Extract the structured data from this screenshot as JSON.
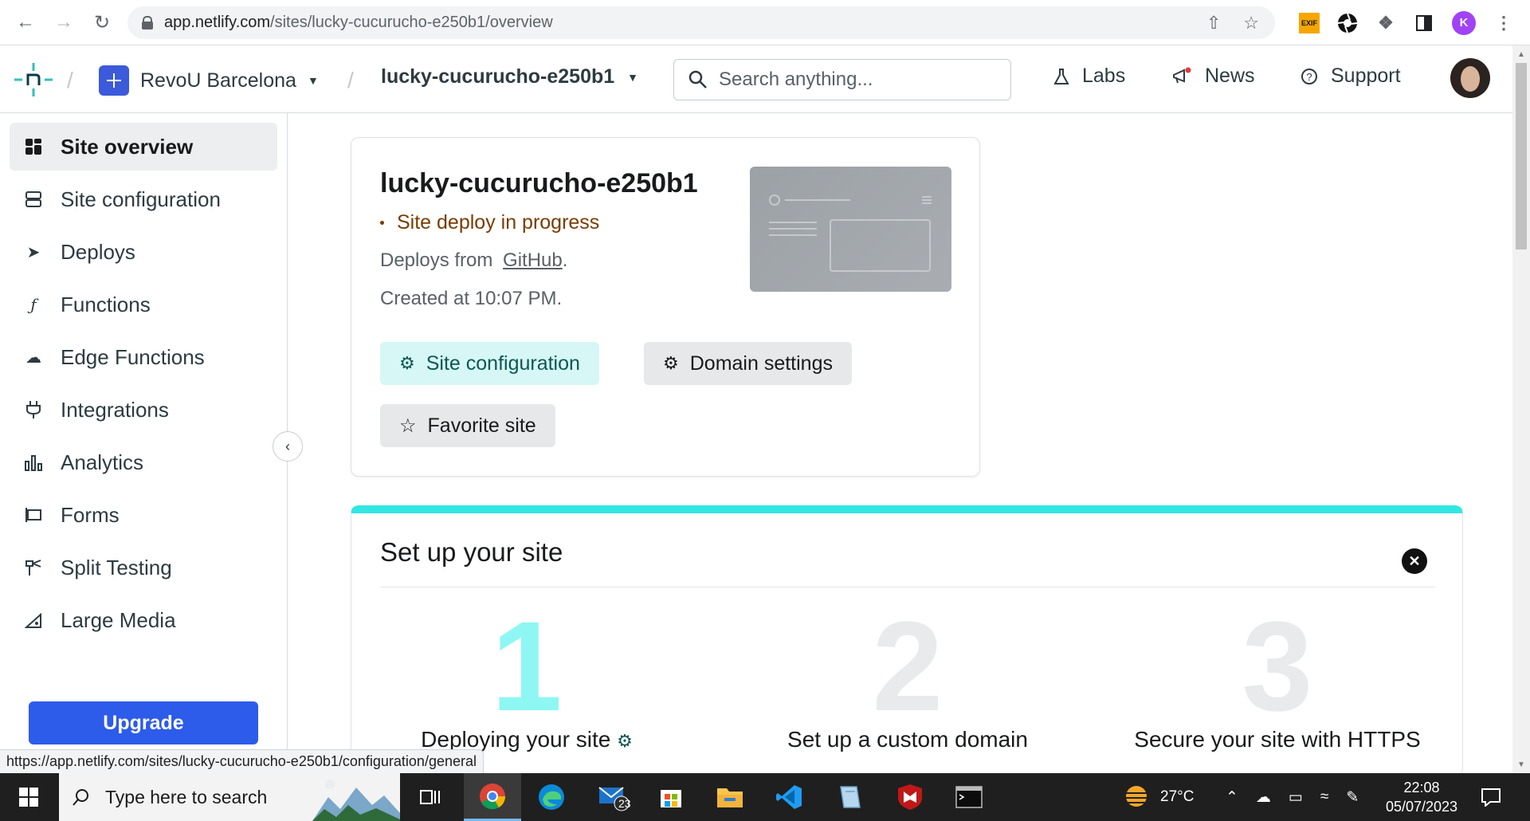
{
  "browser": {
    "url_domain": "app.netlify.com",
    "url_path": "/sites/lucky-cucurucho-e250b1/overview",
    "profile_initial": "K",
    "exif_label": "EXIF"
  },
  "header": {
    "team_name": "RevoU Barcelona",
    "site_name": "lucky-cucurucho-e250b1",
    "search_placeholder": "Search anything...",
    "labs": "Labs",
    "news": "News",
    "support": "Support"
  },
  "sidebar": {
    "items": [
      {
        "label": "Site overview",
        "icon": "grid-icon"
      },
      {
        "label": "Site configuration",
        "icon": "server-icon"
      },
      {
        "label": "Deploys",
        "icon": "rocket-icon"
      },
      {
        "label": "Functions",
        "icon": "function-icon"
      },
      {
        "label": "Edge Functions",
        "icon": "cloud-function-icon"
      },
      {
        "label": "Integrations",
        "icon": "plug-icon"
      },
      {
        "label": "Analytics",
        "icon": "bar-chart-icon"
      },
      {
        "label": "Forms",
        "icon": "form-icon"
      },
      {
        "label": "Split Testing",
        "icon": "signpost-icon"
      },
      {
        "label": "Large Media",
        "icon": "media-icon"
      }
    ],
    "upgrade": "Upgrade"
  },
  "site_card": {
    "title": "lucky-cucurucho-e250b1",
    "status": "Site deploy in progress",
    "deploys_from_prefix": "Deploys from",
    "deploys_from_link": "GitHub",
    "deploys_from_suffix": ".",
    "created_at": "Created at 10:07 PM.",
    "btn_site_config": "Site configuration",
    "btn_domain_settings": "Domain settings",
    "btn_favorite": "Favorite site"
  },
  "setup": {
    "title": "Set up your site",
    "steps": [
      {
        "number": "1",
        "label": "Deploying your site",
        "color": "#8ef7f4"
      },
      {
        "number": "2",
        "label": "Set up a custom domain",
        "color": "#e9eaec"
      },
      {
        "number": "3",
        "label": "Secure your site with HTTPS",
        "color": "#e9eaec"
      }
    ]
  },
  "status_bar_link": "https://app.netlify.com/sites/lucky-cucurucho-e250b1/configuration/general",
  "taskbar": {
    "search_placeholder": "Type here to search",
    "mail_badge": "23",
    "temperature": "27°C",
    "time": "22:08",
    "date": "05/07/2023"
  },
  "colors": {
    "accent_teal": "#32e6e2",
    "upgrade_blue": "#2d5bea",
    "status_brown": "#7a3c00"
  }
}
